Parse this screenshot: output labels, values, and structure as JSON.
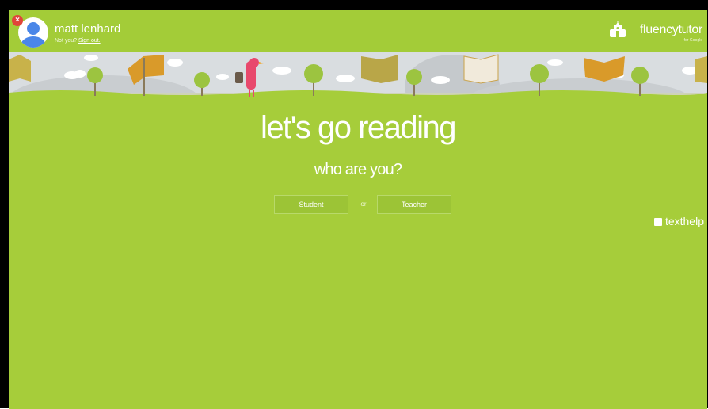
{
  "user": {
    "name": "matt lenhard",
    "not_you": "Not you?",
    "sign_out": "Sign out."
  },
  "brand": {
    "name": "fluencytutor",
    "by": "for Google",
    "icon": "school-reader-icon",
    "color": "#ffffff"
  },
  "main": {
    "headline": "let's go reading",
    "question": "who are you?",
    "student_label": "Student",
    "or_label": "or",
    "teacher_label": "Teacher"
  },
  "footer_brand": {
    "name": "texthelp"
  },
  "colors": {
    "background": "#a6cd3a",
    "banner_sky": "#d9dde0",
    "close_badge": "#e0453a",
    "avatar": "#4a86e8"
  }
}
